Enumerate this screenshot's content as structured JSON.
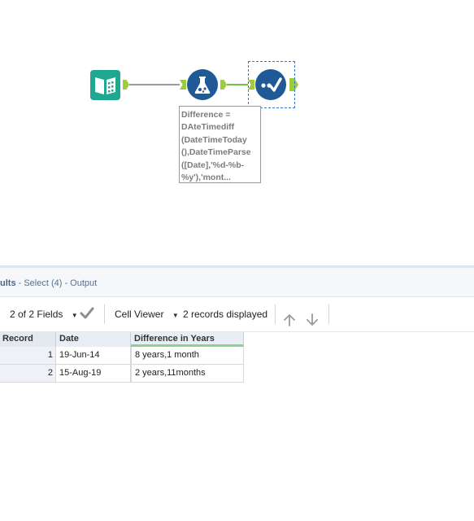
{
  "workflow": {
    "tools": [
      {
        "name": "input-data-tool",
        "icon": "open-book-icon",
        "color": "#1fa88f"
      },
      {
        "name": "formula-tool",
        "icon": "flask-icon",
        "color": "#1f5a96"
      },
      {
        "name": "select-tool",
        "icon": "checkmark-icon",
        "color": "#1f5a96"
      }
    ],
    "formula_annotation": "Difference =\nDAteTimediff\n(DateTimeToday\n(),DateTimeParse\n([Date],'%d-%b-\n%y'),'mont..."
  },
  "results": {
    "title_bold": "ults",
    "title_rest": " - Select (4) - Output",
    "toolbar": {
      "fields_label": "2 of 2 Fields",
      "viewer_label": "Cell Viewer",
      "records_label": "2 records displayed"
    },
    "columns": [
      "Record",
      "Date",
      "Difference in Years"
    ],
    "rows": [
      {
        "record": "1",
        "date": "19-Jun-14",
        "difference": "8 years,1 month"
      },
      {
        "record": "2",
        "date": "15-Aug-19",
        "difference": "2 years,11months"
      }
    ]
  },
  "colors": {
    "anchor_green": "#9ccc3c",
    "tool_blue": "#1f5a96",
    "input_teal": "#1fa88f",
    "header_accent": "#8bd38b"
  }
}
